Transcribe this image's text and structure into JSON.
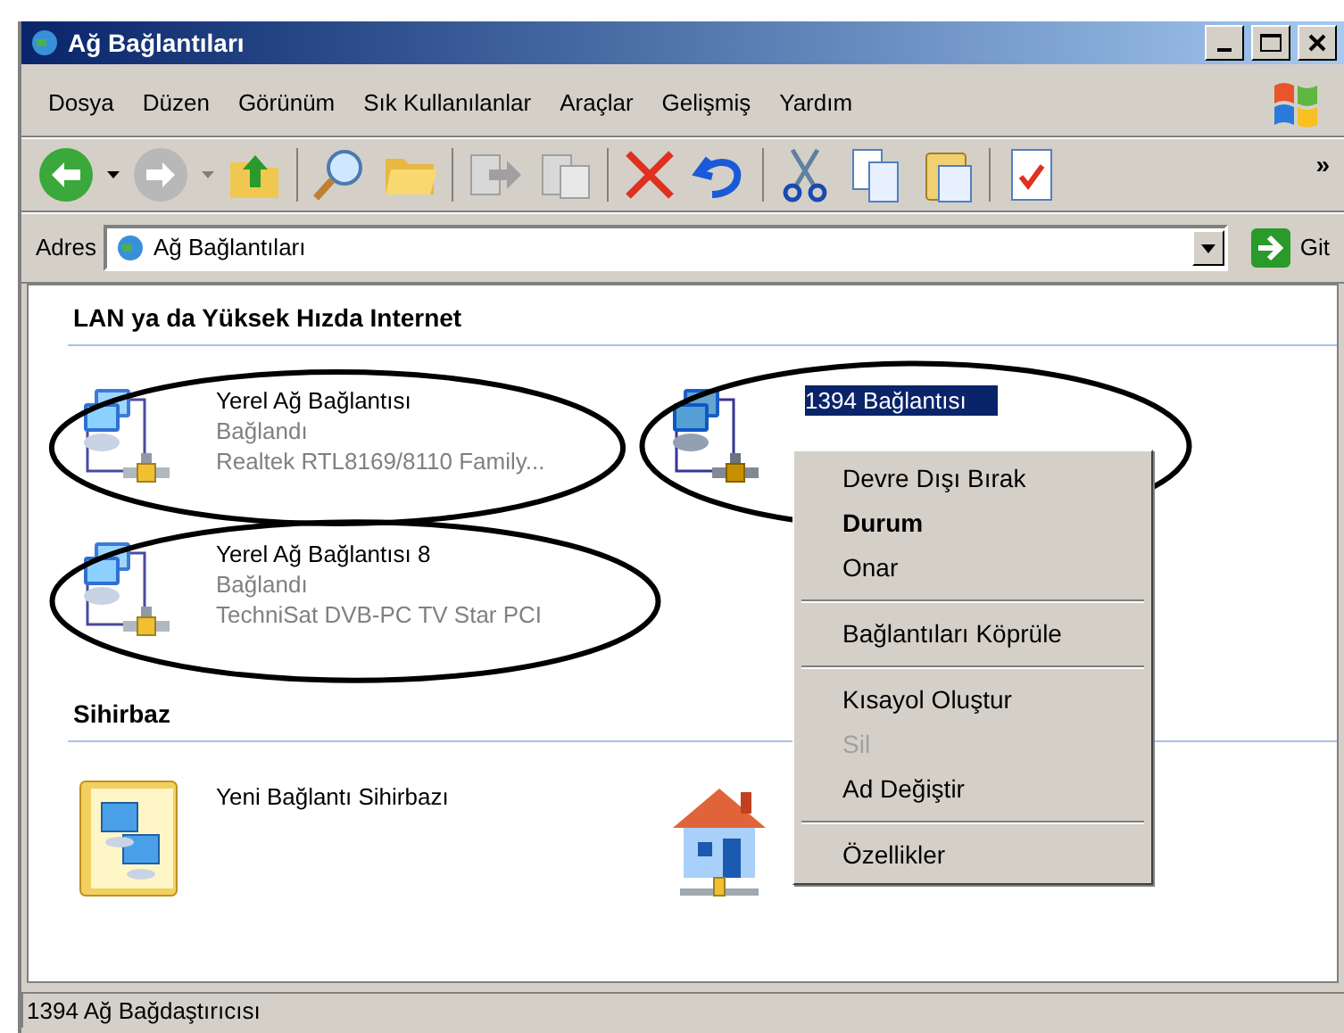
{
  "window": {
    "title": "Ağ Bağlantıları"
  },
  "menu_bar": [
    "Dosya",
    "Düzen",
    "Görünüm",
    "Sık Kullanılanlar",
    "Araçlar",
    "Gelişmiş",
    "Yardım"
  ],
  "toolbar": {
    "overflow": "»"
  },
  "address_bar": {
    "label": "Adres",
    "value": "Ağ Bağlantıları",
    "go_button": "Git"
  },
  "sections": [
    {
      "title": "LAN ya da Yüksek Hızda Internet",
      "items": [
        {
          "kind": "connection",
          "name": "Yerel Ağ Bağlantısı",
          "status": "Bağlandı",
          "device": "Realtek RTL8169/8110 Family...",
          "selected": false
        },
        {
          "kind": "connection",
          "name": "1394 Bağlantısı",
          "selected": true
        },
        {
          "kind": "connection",
          "name": "Yerel Ağ Bağlantısı 8",
          "status": "Bağlandı",
          "device": "TechniSat DVB-PC TV Star PCI",
          "selected": false
        }
      ]
    },
    {
      "title": "Sihirbaz",
      "items": [
        {
          "kind": "wizard",
          "name": "Yeni Bağlantı Sihirbazı",
          "selected": false
        },
        {
          "kind": "home",
          "selected": false
        }
      ]
    }
  ],
  "context_menu": [
    {
      "kind": "item",
      "label": "Devre Dışı Bırak",
      "default": false,
      "disabled": false
    },
    {
      "kind": "item",
      "label": "Durum",
      "default": true,
      "disabled": false
    },
    {
      "kind": "item",
      "label": "Onar",
      "default": false,
      "disabled": false
    },
    {
      "kind": "separator"
    },
    {
      "kind": "item",
      "label": "Bağlantıları Köprüle",
      "default": false,
      "disabled": false
    },
    {
      "kind": "separator"
    },
    {
      "kind": "item",
      "label": "Kısayol Oluştur",
      "default": false,
      "disabled": false
    },
    {
      "kind": "item",
      "label": "Sil",
      "default": false,
      "disabled": true
    },
    {
      "kind": "item",
      "label": "Ad Değiştir",
      "default": false,
      "disabled": false
    },
    {
      "kind": "separator"
    },
    {
      "kind": "item",
      "label": "Özellikler",
      "default": false,
      "disabled": false
    }
  ],
  "status_bar": "1394 Ağ Bağdaştırıcısı"
}
